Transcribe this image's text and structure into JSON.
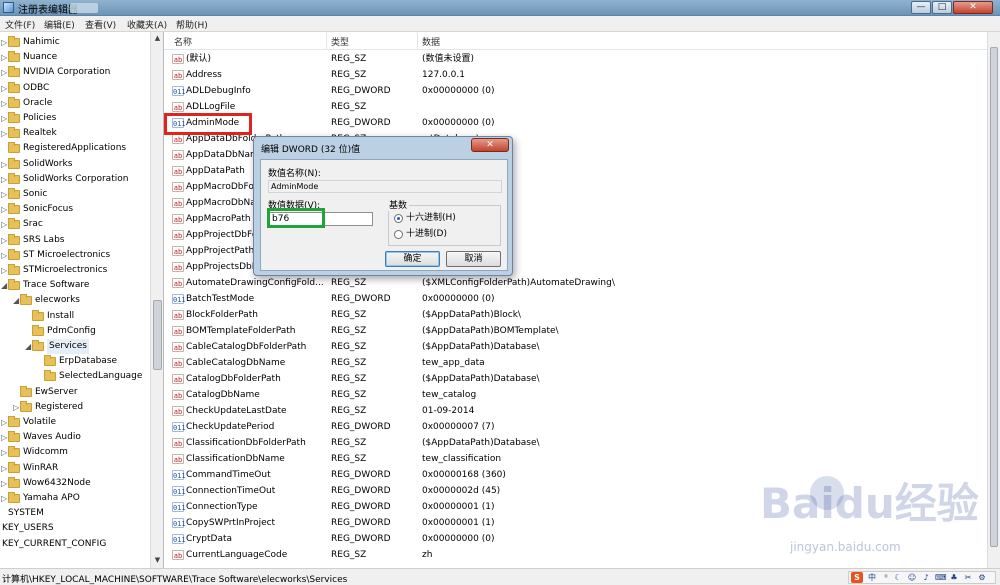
{
  "window": {
    "title": "注册表编辑器",
    "controls": [
      "—",
      "□",
      "✕"
    ]
  },
  "menu": [
    "文件(F)",
    "编辑(E)",
    "查看(V)",
    "收藏夹(A)",
    "帮助(H)"
  ],
  "tree": [
    {
      "label": "Nahimic"
    },
    {
      "label": "Nuance"
    },
    {
      "label": "NVIDIA Corporation"
    },
    {
      "label": "ODBC"
    },
    {
      "label": "Oracle"
    },
    {
      "label": "Policies"
    },
    {
      "label": "Realtek"
    },
    {
      "label": "RegisteredApplications"
    },
    {
      "label": "SolidWorks"
    },
    {
      "label": "SolidWorks Corporation"
    },
    {
      "label": "Sonic"
    },
    {
      "label": "SonicFocus"
    },
    {
      "label": "Srac"
    },
    {
      "label": "SRS Labs"
    },
    {
      "label": "ST Microelectronics"
    },
    {
      "label": "STMicroelectronics"
    },
    {
      "label": "Trace Software"
    },
    {
      "label": "elecworks"
    },
    {
      "label": "Install"
    },
    {
      "label": "PdmConfig"
    },
    {
      "label": "Services"
    },
    {
      "label": "ErpDatabase"
    },
    {
      "label": "SelectedLanguage"
    },
    {
      "label": "EwServer"
    },
    {
      "label": "Registered"
    },
    {
      "label": "Volatile"
    },
    {
      "label": "Waves Audio"
    },
    {
      "label": "Widcomm"
    },
    {
      "label": "WinRAR"
    },
    {
      "label": "Wow6432Node"
    },
    {
      "label": "Yamaha APO"
    },
    {
      "label": "SYSTEM"
    },
    {
      "label": "KEY_USERS"
    },
    {
      "label": "KEY_CURRENT_CONFIG"
    }
  ],
  "list": {
    "headers": {
      "name": "名称",
      "type": "类型",
      "data": "数据"
    },
    "rows": [
      {
        "icon": "ab",
        "name": "(默认)",
        "type": "REG_SZ",
        "data": "(数值未设置)"
      },
      {
        "icon": "ab",
        "name": "Address",
        "type": "REG_SZ",
        "data": "127.0.0.1"
      },
      {
        "icon": "dw",
        "name": "ADLDebugInfo",
        "type": "REG_DWORD",
        "data": "0x00000000 (0)"
      },
      {
        "icon": "ab",
        "name": "ADLLogFile",
        "type": "REG_SZ",
        "data": ""
      },
      {
        "icon": "dw",
        "name": "AdminMode",
        "type": "REG_DWORD",
        "data": "0x00000000 (0)"
      },
      {
        "icon": "ab",
        "name": "AppDataDbFolderPath",
        "type": "REG_SZ",
        "data": "...\\Database\\"
      },
      {
        "icon": "ab",
        "name": "AppDataDbName",
        "type": "REG_SZ",
        "data": ""
      },
      {
        "icon": "ab",
        "name": "AppDataPath",
        "type": "REG_SZ",
        "data": "...worksdata\\"
      },
      {
        "icon": "ab",
        "name": "AppMacroDbFolderPath",
        "type": "REG_SZ",
        "data": "...Database\\"
      },
      {
        "icon": "ab",
        "name": "AppMacroDbName",
        "type": "REG_SZ",
        "data": ""
      },
      {
        "icon": "ab",
        "name": "AppMacroPath",
        "type": "REG_SZ",
        "data": "...os\\"
      },
      {
        "icon": "ab",
        "name": "AppProjectDbFolderPath",
        "type": "REG_SZ",
        "data": "...Database\\"
      },
      {
        "icon": "ab",
        "name": "AppProjectPath",
        "type": "REG_SZ",
        "data": "...ects\\"
      },
      {
        "icon": "ab",
        "name": "AppProjectsDbName",
        "type": "REG_SZ",
        "data": ""
      },
      {
        "icon": "ab",
        "name": "AutomateDrawingConfigFold...",
        "type": "REG_SZ",
        "data": "($XMLConfigFolderPath)AutomateDrawing\\"
      },
      {
        "icon": "dw",
        "name": "BatchTestMode",
        "type": "REG_DWORD",
        "data": "0x00000000 (0)"
      },
      {
        "icon": "ab",
        "name": "BlockFolderPath",
        "type": "REG_SZ",
        "data": "($AppDataPath)Block\\"
      },
      {
        "icon": "ab",
        "name": "BOMTemplateFolderPath",
        "type": "REG_SZ",
        "data": "($AppDataPath)BOMTemplate\\"
      },
      {
        "icon": "ab",
        "name": "CableCatalogDbFolderPath",
        "type": "REG_SZ",
        "data": "($AppDataPath)Database\\"
      },
      {
        "icon": "ab",
        "name": "CableCatalogDbName",
        "type": "REG_SZ",
        "data": "tew_app_data"
      },
      {
        "icon": "ab",
        "name": "CatalogDbFolderPath",
        "type": "REG_SZ",
        "data": "($AppDataPath)Database\\"
      },
      {
        "icon": "ab",
        "name": "CatalogDbName",
        "type": "REG_SZ",
        "data": "tew_catalog"
      },
      {
        "icon": "ab",
        "name": "CheckUpdateLastDate",
        "type": "REG_SZ",
        "data": "01-09-2014"
      },
      {
        "icon": "dw",
        "name": "CheckUpdatePeriod",
        "type": "REG_DWORD",
        "data": "0x00000007 (7)"
      },
      {
        "icon": "ab",
        "name": "ClassificationDbFolderPath",
        "type": "REG_SZ",
        "data": "($AppDataPath)Database\\"
      },
      {
        "icon": "ab",
        "name": "ClassificationDbName",
        "type": "REG_SZ",
        "data": "tew_classification"
      },
      {
        "icon": "dw",
        "name": "CommandTimeOut",
        "type": "REG_DWORD",
        "data": "0x00000168 (360)"
      },
      {
        "icon": "dw",
        "name": "ConnectionTimeOut",
        "type": "REG_DWORD",
        "data": "0x0000002d (45)"
      },
      {
        "icon": "dw",
        "name": "ConnectionType",
        "type": "REG_DWORD",
        "data": "0x00000001 (1)"
      },
      {
        "icon": "dw",
        "name": "CopySWPrtInProject",
        "type": "REG_DWORD",
        "data": "0x00000001 (1)"
      },
      {
        "icon": "dw",
        "name": "CryptData",
        "type": "REG_DWORD",
        "data": "0x00000000 (0)"
      },
      {
        "icon": "ab",
        "name": "CurrentLanguageCode",
        "type": "REG_SZ",
        "data": "zh"
      }
    ]
  },
  "status_path": "计算机\\HKEY_LOCAL_MACHINE\\SOFTWARE\\Trace Software\\elecworks\\Services",
  "dialog": {
    "title": "编辑 DWORD (32 位)值",
    "close": "✕",
    "name_label": "数值名称(N):",
    "name_value": "AdminMode",
    "data_label": "数值数据(V):",
    "data_value": "b76",
    "radix_label": "基数",
    "hex_label": "十六进制(H)",
    "dec_label": "十进制(D)",
    "ok": "确定",
    "cancel": "取消"
  },
  "ime": {
    "badge": "S",
    "text": "中"
  },
  "watermark": {
    "logo": "Baidu经验",
    "url": "jingyan.baidu.com"
  },
  "colors": {
    "highlight_red": "#e0231c",
    "highlight_green": "#21a33a"
  }
}
